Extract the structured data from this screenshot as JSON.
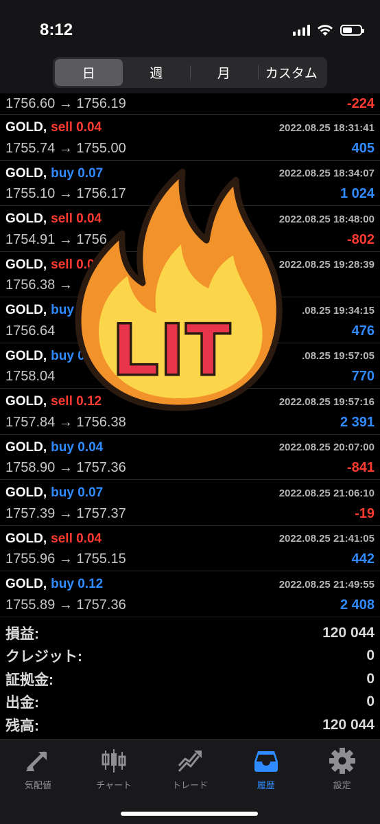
{
  "status": {
    "time": "8:12"
  },
  "segments": [
    {
      "label": "日",
      "active": true
    },
    {
      "label": "週"
    },
    {
      "label": "月"
    },
    {
      "label": "カスタム"
    }
  ],
  "partial_row": {
    "prices": "1756.60 → 1756.19",
    "profit": "-224"
  },
  "trades": [
    {
      "symbol": "GOLD,",
      "side": "sell 0.04",
      "time": "2022.08.25 18:31:41",
      "prices": "1755.74 → 1755.00",
      "profit": "405"
    },
    {
      "symbol": "GOLD,",
      "side": "buy 0.07",
      "time": "2022.08.25 18:34:07",
      "prices": "1755.10 → 1756.17",
      "profit": "1 024"
    },
    {
      "symbol": "GOLD,",
      "side": "sell 0.04",
      "time": "2022.08.25 18:48:00",
      "prices": "1754.91 → 1756.",
      "profit": "-802"
    },
    {
      "symbol": "GOLD,",
      "side": "sell 0.0",
      "time": "2022.08.25 19:28:39",
      "prices": "1756.38 →",
      "profit": ""
    },
    {
      "symbol": "GOLD,",
      "side": "buy 0",
      "time": ".08.25 19:34:15",
      "prices": "1756.64",
      "profit": "476"
    },
    {
      "symbol": "GOLD,",
      "side": "buy 0",
      "time": ".08.25 19:57:05",
      "prices": "1758.04",
      "profit": "770"
    },
    {
      "symbol": "GOLD,",
      "side": "sell 0.12",
      "time": "2022.08.25 19:57:16",
      "prices": "1757.84 → 1756.38",
      "profit": "2 391"
    },
    {
      "symbol": "GOLD,",
      "side": "buy 0.04",
      "time": "2022.08.25 20:07:00",
      "prices": "1758.90 → 1757.36",
      "profit": "-841"
    },
    {
      "symbol": "GOLD,",
      "side": "buy 0.07",
      "time": "2022.08.25 21:06:10",
      "prices": "1757.39 → 1757.37",
      "profit": "-19"
    },
    {
      "symbol": "GOLD,",
      "side": "sell 0.04",
      "time": "2022.08.25 21:41:05",
      "prices": "1755.96 → 1755.15",
      "profit": "442"
    },
    {
      "symbol": "GOLD,",
      "side": "buy 0.12",
      "time": "2022.08.25 21:49:55",
      "prices": "1755.89 → 1757.36",
      "profit": "2 408"
    }
  ],
  "summary": [
    {
      "label": "損益:",
      "value": "120 044"
    },
    {
      "label": "クレジット:",
      "value": "0"
    },
    {
      "label": "証拠金:",
      "value": "0"
    },
    {
      "label": "出金:",
      "value": "0"
    },
    {
      "label": "残高:",
      "value": "120 044"
    }
  ],
  "sticker": {
    "text": "LIT"
  },
  "tabs": [
    {
      "label": "気配値",
      "icon": "quotes-arrows-icon"
    },
    {
      "label": "チャート",
      "icon": "candlestick-chart-icon"
    },
    {
      "label": "トレード",
      "icon": "trade-trend-icon"
    },
    {
      "label": "履歴",
      "icon": "history-inbox-icon",
      "active": true
    },
    {
      "label": "設定",
      "icon": "gear-icon"
    }
  ],
  "colors": {
    "sell": "#ff3b30",
    "buy": "#2f8bff",
    "active_tab": "#2f8bff",
    "inactive_tab": "#8e8e93"
  }
}
